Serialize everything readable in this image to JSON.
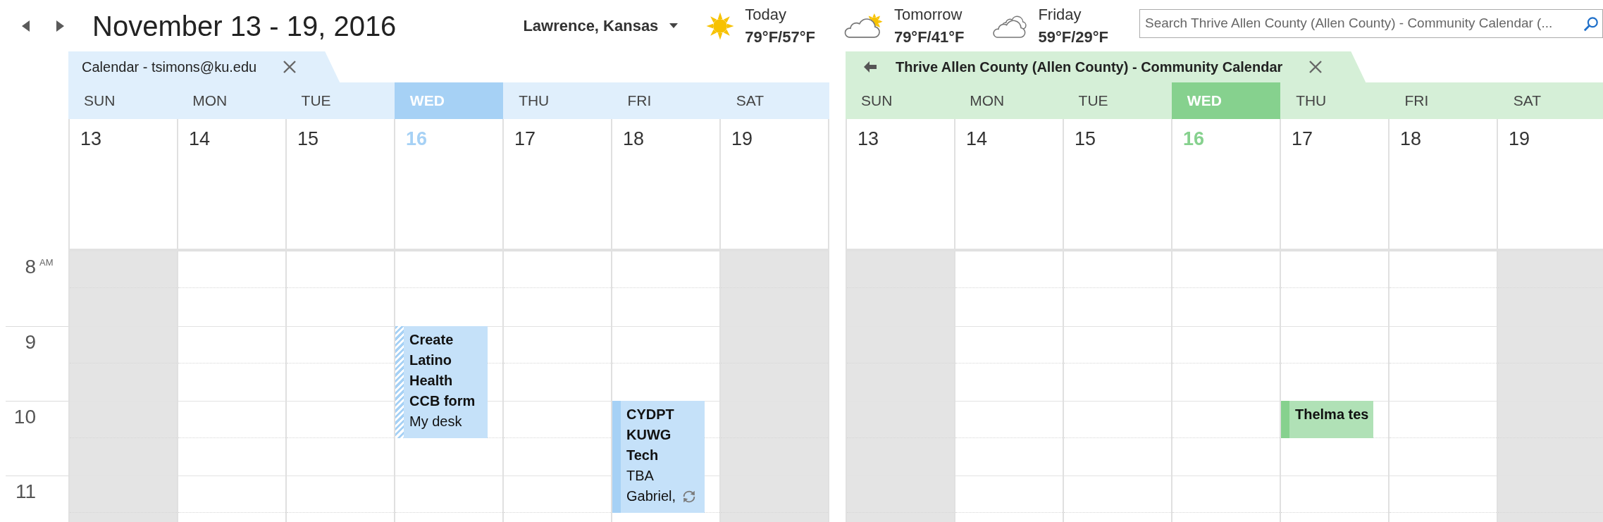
{
  "toolbar": {
    "title": "November 13 - 19, 2016",
    "location": "Lawrence, Kansas"
  },
  "weather": [
    {
      "kind": "sunny",
      "day": "Today",
      "temps": "79°F/57°F"
    },
    {
      "kind": "partly_cloudy",
      "day": "Tomorrow",
      "temps": "79°F/41°F"
    },
    {
      "kind": "cloudy",
      "day": "Friday",
      "temps": "59°F/29°F"
    }
  ],
  "search": {
    "placeholder": "Search Thrive Allen County (Allen County) - Community Calendar (..."
  },
  "time_labels": [
    {
      "hour": "8",
      "suffix": "AM"
    },
    {
      "hour": "9"
    },
    {
      "hour": "10"
    },
    {
      "hour": "11"
    }
  ],
  "calendars": [
    {
      "tab": {
        "label": "Calendar - tsimons@ku.edu",
        "selected": false,
        "arrow": false
      },
      "color": "#a6d1f5",
      "days": [
        {
          "name": "SUN",
          "date": "13",
          "today": false,
          "weekend": true
        },
        {
          "name": "MON",
          "date": "14",
          "today": false,
          "weekend": false
        },
        {
          "name": "TUE",
          "date": "15",
          "today": false,
          "weekend": false
        },
        {
          "name": "WED",
          "date": "16",
          "today": true,
          "weekend": false,
          "timeline": [
            {
              "kind": "free"
            },
            {
              "kind": "free"
            },
            {
              "kind": "event",
              "title": "Create Latino Health CCB form",
              "location": "My desk",
              "tentative": true,
              "recurring": false
            },
            {
              "kind": "continued"
            },
            {
              "kind": "continued"
            }
          ]
        },
        {
          "name": "THU",
          "date": "17",
          "today": false,
          "weekend": false
        },
        {
          "name": "FRI",
          "date": "18",
          "today": false,
          "weekend": false,
          "timeline": [
            {
              "kind": "free"
            },
            {
              "kind": "free"
            },
            {
              "kind": "free"
            },
            {
              "kind": "free"
            },
            {
              "kind": "event",
              "title": "CYDPT KUWG Tech",
              "location": "TBA",
              "organizer": "Gabriel,",
              "tentative": false,
              "recurring": true
            },
            {
              "kind": "continued"
            },
            {
              "kind": "continued"
            }
          ]
        },
        {
          "name": "SAT",
          "date": "19",
          "today": false,
          "weekend": true
        }
      ]
    },
    {
      "tab": {
        "label": "Thrive Allen County (Allen County) - Community Calendar",
        "selected": true,
        "arrow": true
      },
      "color": "#86d18e",
      "days": [
        {
          "name": "SUN",
          "date": "13",
          "today": false,
          "weekend": true
        },
        {
          "name": "MON",
          "date": "14",
          "today": false,
          "weekend": false
        },
        {
          "name": "TUE",
          "date": "15",
          "today": false,
          "weekend": false
        },
        {
          "name": "WED",
          "date": "16",
          "today": true,
          "weekend": false
        },
        {
          "name": "THU",
          "date": "17",
          "today": false,
          "weekend": false,
          "timeline": [
            {
              "kind": "free"
            },
            {
              "kind": "free"
            },
            {
              "kind": "free"
            },
            {
              "kind": "free"
            },
            {
              "kind": "event",
              "title": "Thelma tes",
              "tentative": false,
              "recurring": false
            }
          ]
        },
        {
          "name": "FRI",
          "date": "18",
          "today": false,
          "weekend": false
        },
        {
          "name": "SAT",
          "date": "19",
          "today": false,
          "weekend": true
        }
      ]
    }
  ]
}
